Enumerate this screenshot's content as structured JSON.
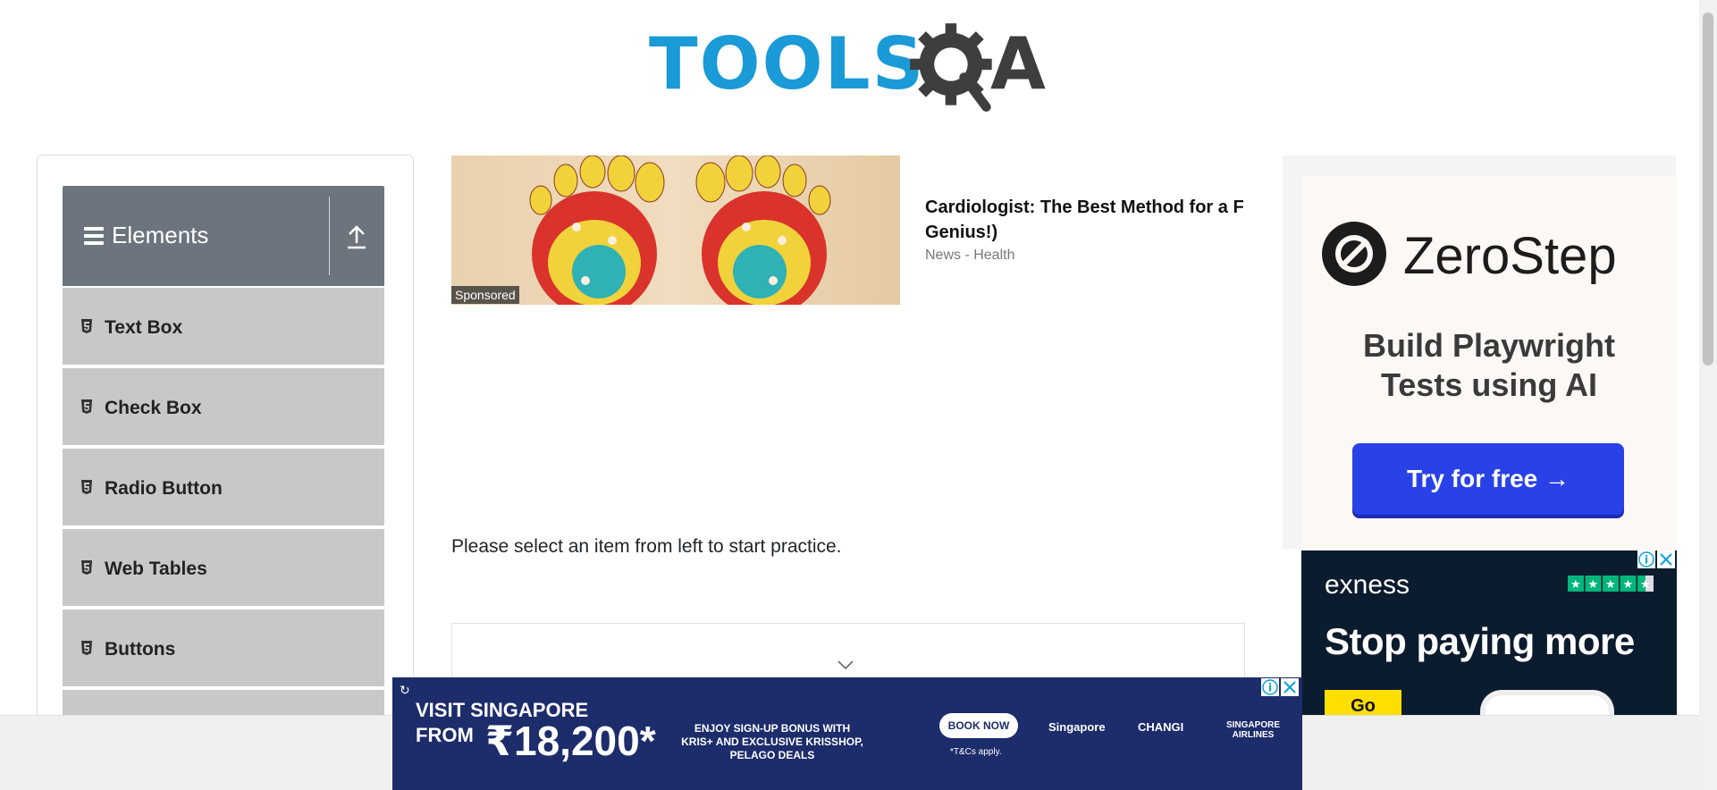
{
  "header": {
    "logo_tools": "TOOLS",
    "logo_a": "A",
    "logo_color_primary": "#1a9ad6",
    "logo_color_secondary": "#3e3e3e"
  },
  "sidebar": {
    "group_title": "Elements",
    "group_icon": "hamburger-menu-icon",
    "collapse_icon": "upload-arrow-icon",
    "items": [
      {
        "label": "Text Box",
        "icon": "html5-icon"
      },
      {
        "label": "Check Box",
        "icon": "html5-icon"
      },
      {
        "label": "Radio Button",
        "icon": "html5-icon"
      },
      {
        "label": "Web Tables",
        "icon": "html5-icon"
      },
      {
        "label": "Buttons",
        "icon": "html5-icon"
      }
    ]
  },
  "sponsored": {
    "tag": "Sponsored",
    "title_line1": "Cardiologist: The Best Method for a F",
    "title_line2": "Genius!)",
    "source": "News - Health"
  },
  "main": {
    "instruction": "Please select an item from left to start practice."
  },
  "ads": {
    "zerostep": {
      "brand": "ZeroStep",
      "tagline_line1": "Build Playwright",
      "tagline_line2": "Tests using AI",
      "cta": "Try for free →",
      "cta_color": "#2942e8"
    },
    "exness": {
      "brand": "exness",
      "headline": "Stop paying more",
      "cta": "Go",
      "cta_color": "#ffde02"
    },
    "singapore": {
      "line1": "VISIT SINGAPORE",
      "line2": "FROM",
      "price": "₹18,200*",
      "offer": "ENJOY SIGN-UP BONUS WITH KRIS+ AND EXCLUSIVE KRISSHOP, PELAGO DEALS",
      "cta": "BOOK NOW",
      "terms": "*T&Cs apply.",
      "partner1": "Singapore",
      "partner2": "CHANGI",
      "partner3": "SINGAPORE AIRLINES"
    }
  }
}
